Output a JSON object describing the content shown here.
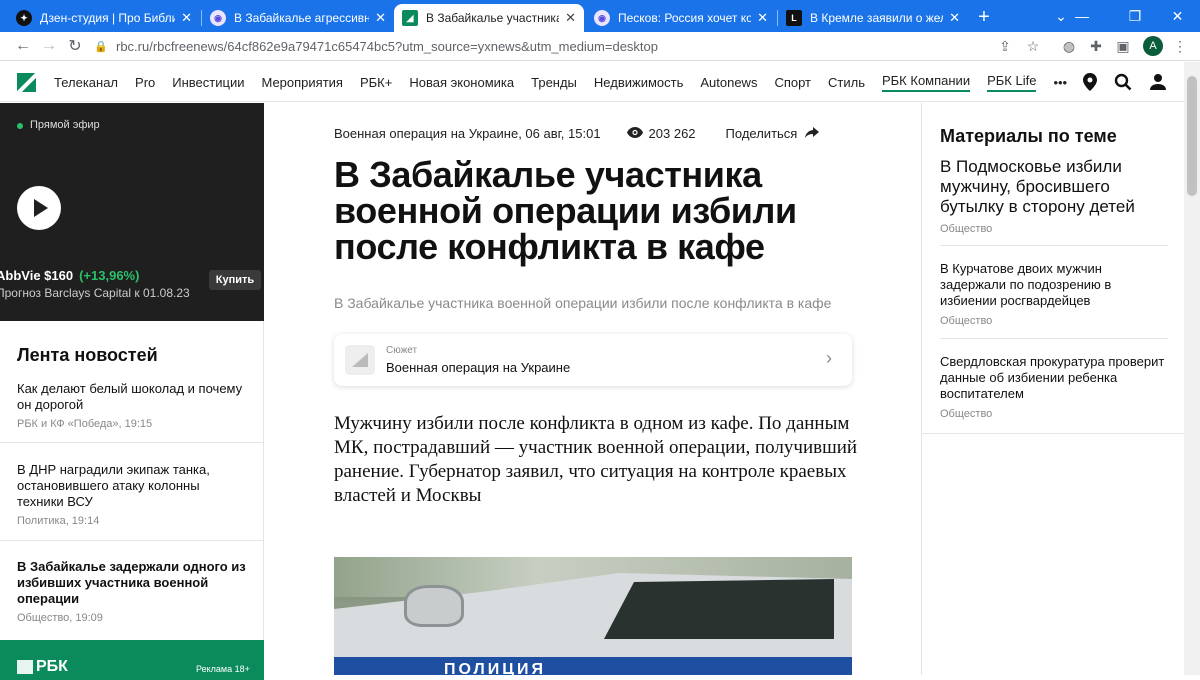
{
  "browser": {
    "tabs": [
      {
        "title": "Дзен-студия | Про Библию с",
        "active": false
      },
      {
        "title": "В Забайкалье агрессивная м",
        "active": false
      },
      {
        "title": "В Забайкалье участника вое",
        "active": true
      },
      {
        "title": "Песков: Россия хочет контр",
        "active": false
      },
      {
        "title": "В Кремле заявили о желани",
        "active": false
      }
    ],
    "url": "rbc.ru/rbcfreenews/64cf862e9a79471c65474bc5?utm_source=yxnews&utm_medium=desktop",
    "profile_initial": "A",
    "accent_color": "#1a73e8"
  },
  "site": {
    "brand_color": "#0b8b5c",
    "nav": [
      "Телеканал",
      "Pro",
      "Инвестиции",
      "Мероприятия",
      "РБК+",
      "Новая экономика",
      "Тренды",
      "Недвижимость",
      "Autonews",
      "Спорт",
      "Стиль",
      "РБК Компании",
      "РБК Life"
    ],
    "more": "•••"
  },
  "left": {
    "live_label": "Прямой эфир",
    "ticker_name": "AbbVie $160",
    "ticker_change": "(+13,96%)",
    "forecast": "Прогноз Barclays Capital к 01.08.23",
    "buy_label": "Купить",
    "feed_title": "Лента новостей",
    "feed": [
      {
        "title": "Как делают белый шоколад и почему он дорогой",
        "meta": "РБК и КФ «Победа», 19:15",
        "bold": false
      },
      {
        "title": "В ДНР наградили экипаж танка, остановившего атаку колонны техники ВСУ",
        "meta": "Политика, 19:14",
        "bold": false
      },
      {
        "title": "В Забайкалье задержали одного из избивших участника военной операции",
        "meta": "Общество, 19:09",
        "bold": true
      }
    ],
    "banner_logo": "РБК",
    "banner_ad": "Реклама 18+"
  },
  "article": {
    "category_date": "Военная операция на Украине, 06 авг, 15:01",
    "views": "203 262",
    "share_label": "Поделиться",
    "headline": "В Забайкалье участника военной операции избили после конфликта в кафе",
    "subtitle": "В Забайкалье участника военной операции избили после конфликта в кафе",
    "story_label": "Сюжет",
    "story_name": "Военная операция на Украине",
    "lead": "Мужчину избили после конфликта в одном из кафе. По данным МК, пострадавший — участник военной операции, получивший ранение. Губернатор заявил, что ситуация на контроле краевых властей и Москвы",
    "photo_text": "ПОЛИЦИЯ"
  },
  "related": {
    "title": "Материалы по теме",
    "items": [
      {
        "title": "В Подмосковье избили мужчину, бросившего бутылку в сторону детей",
        "meta": "Общество"
      },
      {
        "title": "В Курчатове двоих мужчин задержали по подозрению в избиении росгвардейцев",
        "meta": "Общество"
      },
      {
        "title": "Свердловская прокуратура проверит данные об избиении ребенка воспитателем",
        "meta": "Общество"
      }
    ]
  }
}
